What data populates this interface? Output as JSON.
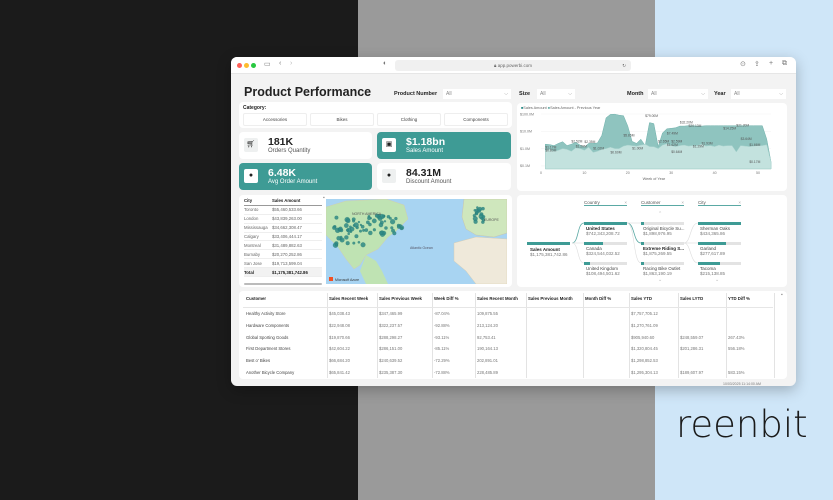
{
  "browser": {
    "url": "app.powerbi.com"
  },
  "brand": {
    "logo_text": "reenbit"
  },
  "colors": {
    "accent": "#3e9b95",
    "chart_current": "#8fc4bf",
    "chart_previous": "#c3e2de"
  },
  "header": {
    "title": "Product Performance",
    "product_number_label": "Product Number",
    "product_number_value": "All",
    "size_label": "Size",
    "size_value": "All",
    "month_label": "Month",
    "month_value": "All",
    "year_label": "Year",
    "year_value": "All"
  },
  "category": {
    "label": "Category:",
    "buttons": [
      "Accessories",
      "Bikes",
      "Clothing",
      "Components"
    ]
  },
  "kpis": [
    {
      "value": "181K",
      "caption": "Orders Quantity",
      "icon": "cart-icon"
    },
    {
      "value": "$1.18bn",
      "caption": "Sales Amount",
      "icon": "money-icon"
    },
    {
      "value": "6.48K",
      "caption": "Avg Order Amount",
      "icon": "dollar-coin-icon"
    },
    {
      "value": "84.31M",
      "caption": "Discount Amount",
      "icon": "dollar-coin-icon"
    }
  ],
  "chart_data": {
    "type": "area",
    "title": "",
    "xlabel": "Week of Year",
    "ylabel": "",
    "yscale": "log",
    "ylim": [
      0.1,
      100
    ],
    "yticks": [
      "$0.1M",
      "$1.0M",
      "$10.0M",
      "$100.0M"
    ],
    "ytick_values": [
      0.1,
      1,
      10,
      100
    ],
    "xticks": [
      0,
      10,
      20,
      30,
      40,
      50
    ],
    "legend": [
      "Sales Amount",
      "Sales Amount - Previous Year"
    ],
    "legend_position": "top-left",
    "series": [
      {
        "name": "Sales Amount",
        "values": [
          1.8,
          1.7,
          1.5,
          2.0,
          2.5,
          1.5,
          1.8,
          2.3,
          1.6,
          1.2,
          2.0,
          2.0,
          2.1,
          5.8,
          60,
          95,
          98,
          85,
          80,
          20,
          2.6,
          2.0,
          3.5,
          1.5,
          32,
          28,
          1.3,
          8,
          14,
          15,
          16,
          20,
          20,
          21,
          21,
          20,
          20,
          21,
          21,
          21,
          21,
          21,
          21,
          21,
          21,
          21,
          21,
          21,
          21,
          21,
          21,
          3.6,
          0.17
        ]
      },
      {
        "name": "Sales Amount - Previous Year",
        "values": [
          0.8,
          0.9,
          0.7,
          0.8,
          1.0,
          0.9,
          0.7,
          1.1,
          1.0,
          0.8,
          1.2,
          0.6,
          0.7,
          0.9,
          1.0,
          1.2,
          1.0,
          1.0,
          1.4,
          1.6,
          1.5,
          1.4,
          1.6,
          1.8,
          1.3,
          1.29,
          1.0,
          1.6,
          1.9,
          1.5,
          1.3,
          1.5,
          1.6,
          1.4,
          1.5,
          1.5,
          1.8,
          1.4,
          1.5,
          1.3,
          1.6,
          1.4,
          1.5,
          1.5,
          0.64,
          1.5,
          1.4,
          1.3,
          1.4,
          1.5,
          1.5,
          1.66,
          0.17
        ]
      }
    ],
    "data_labels": [
      {
        "week": 1,
        "value": 1.17,
        "text": "$1.17M"
      },
      {
        "week": 1,
        "value": 0.8,
        "text": "$0.80M"
      },
      {
        "week": 7,
        "value": 2.52,
        "text": "$2.52M"
      },
      {
        "week": 10,
        "value": 2.35,
        "text": "$2.35M"
      },
      {
        "week": 8,
        "value": 1.29,
        "text": "$1.29M"
      },
      {
        "week": 12,
        "value": 1.02,
        "text": "$1.02M"
      },
      {
        "week": 16,
        "value": 0.6,
        "text": "$0.60M"
      },
      {
        "week": 19,
        "value": 5.85,
        "text": "$5.85M"
      },
      {
        "week": 24,
        "value": 79,
        "text": "$79.00M"
      },
      {
        "week": 21,
        "value": 1.0,
        "text": "$1.00M"
      },
      {
        "week": 27,
        "value": 2.65,
        "text": "$2.65M"
      },
      {
        "week": 29,
        "value": 1.62,
        "text": "$1.62M"
      },
      {
        "week": 32,
        "value": 32.2,
        "text": "$32.20M"
      },
      {
        "week": 34,
        "value": 20.13,
        "text": "$20.13M"
      },
      {
        "week": 35,
        "value": 1.29,
        "text": "$1.29M"
      },
      {
        "week": 37,
        "value": 1.93,
        "text": "$1.93M"
      },
      {
        "week": 42,
        "value": 14.25,
        "text": "$14.25M"
      },
      {
        "week": 60,
        "value": 2.59,
        "text": "$2.59M"
      },
      {
        "week": 59,
        "value": 7.49,
        "text": "$7.49M"
      },
      {
        "week": 60,
        "value": 0.64,
        "text": "$0.64M"
      },
      {
        "week": 75,
        "value": 21.2,
        "text": "$21.20M"
      },
      {
        "week": 76,
        "value": 3.64,
        "text": "$3.64M"
      },
      {
        "week": 78,
        "value": 1.66,
        "text": "$1.66M"
      },
      {
        "week": 78,
        "value": 0.17,
        "text": "$0.17M"
      }
    ]
  },
  "city_table": {
    "headers": [
      "City",
      "Sales Amount"
    ],
    "rows": [
      [
        "Toronto",
        "$55,460,533.66"
      ],
      [
        "London",
        "$43,839,263.00"
      ],
      [
        "Mississauga",
        "$34,662,308.47"
      ],
      [
        "Calgary",
        "$33,406,444.17"
      ],
      [
        "Montreal",
        "$31,489,882.63"
      ],
      [
        "Burnaby",
        "$20,270,252.86"
      ],
      [
        "San Jose",
        "$19,713,599.04"
      ]
    ],
    "total_label": "Total",
    "total_value": "$1,175,381,742.86"
  },
  "map": {
    "labels": [
      "NORTH AMERICA",
      "EUROPE",
      "Atlantic Ocean"
    ],
    "attribution": "Microsoft Azure"
  },
  "decomp": {
    "root": {
      "label": "Sales Amount",
      "value": "$1,175,381,742.86"
    },
    "columns": [
      {
        "header": "Country",
        "items": [
          {
            "label": "United States",
            "value": "$742,343,208.72",
            "bold": true,
            "pct": 1
          },
          {
            "label": "Canada",
            "value": "$324,544,032.52",
            "pct": 0.44
          },
          {
            "label": "United Kingdom",
            "value": "$108,494,501.62",
            "pct": 0.15
          }
        ]
      },
      {
        "header": "Customer",
        "items": [
          {
            "label": "Original Bicycle Su...",
            "value": "$1,898,976.95",
            "pct": 0.06
          },
          {
            "label": "Extreme Riding S...",
            "value": "$1,875,269.55",
            "bold": true,
            "pct": 0.06
          },
          {
            "label": "Racing Bike Outlet",
            "value": "$1,863,190.19",
            "pct": 0.06
          }
        ]
      },
      {
        "header": "City",
        "items": [
          {
            "label": "Sherman Oaks",
            "value": "$434,365.86",
            "pct": 1
          },
          {
            "label": "Garland",
            "value": "$277,617.89",
            "pct": 0.64
          },
          {
            "label": "Tacoma",
            "value": "$215,138.85",
            "pct": 0.5
          }
        ]
      }
    ]
  },
  "sales_table": {
    "headers": [
      "Customer",
      "Sales Recent Week",
      "Sales Previous Week",
      "Week Diff %",
      "Sales Recent Month",
      "Sales Previous Month",
      "Month Diff %",
      "Sales YTD",
      "Sales LYTD",
      "YTD Diff %"
    ],
    "rows": [
      [
        "Healthy Activity Store",
        "$45,038.43",
        "$347,465.99",
        "-87.04%",
        "109,875.55",
        "",
        "",
        "$7,757,705.12",
        "",
        ""
      ],
      [
        "Hardware Components",
        "$22,948.08",
        "$322,237.57",
        "-92.88%",
        "213,124.20",
        "",
        "",
        "$1,270,761.09",
        "",
        ""
      ],
      [
        "Global Sporting Goods",
        "$19,870.66",
        "$288,298.27",
        "-93.11%",
        "92,753.41",
        "",
        "",
        "$905,940.60",
        "$248,559.07",
        "267.43%"
      ],
      [
        "First Department Stores",
        "$42,604.22",
        "$286,151.00",
        "-85.11%",
        "190,164.13",
        "",
        "",
        "$1,320,804.45",
        "$201,286.31",
        "556.18%"
      ],
      [
        "Best o' Bikes",
        "$66,684.20",
        "$240,639.52",
        "-72.29%",
        "202,891.01",
        "",
        "",
        "$1,298,852.53",
        "",
        ""
      ],
      [
        "Another Bicycle Company",
        "$65,841.42",
        "$235,387.30",
        "-72.88%",
        "228,485.89",
        "",
        "",
        "$1,295,304.13",
        "$189,607.97",
        "583.15%"
      ]
    ]
  },
  "footer": {
    "timestamp": "10/03/2025 11:14:00 AM"
  }
}
